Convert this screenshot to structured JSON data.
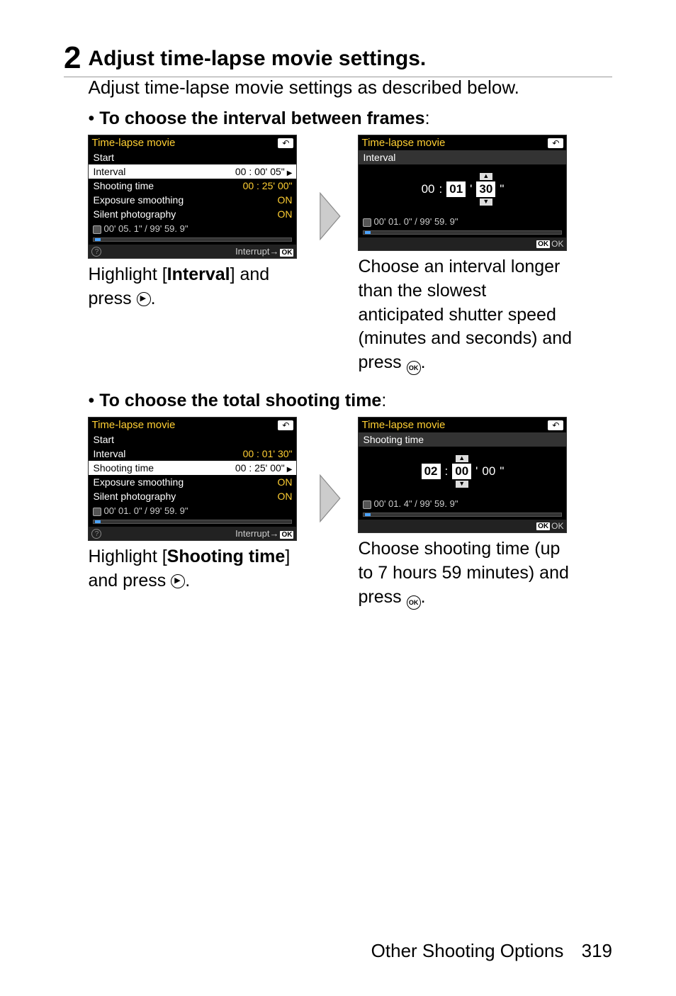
{
  "step": {
    "num": "2",
    "title": "Adjust time-lapse movie settings.",
    "desc": "Adjust time-lapse movie settings as described below."
  },
  "sectionA": {
    "heading_prefix": "• ",
    "heading_bold": "To choose the interval between frames",
    "heading_suffix": ":",
    "left_caption_a": "Highlight [",
    "left_caption_b": "Interval",
    "left_caption_c": "] and press ",
    "left_caption_d": ".",
    "right_caption_a": "Choose an interval longer than the slowest anticipated shutter speed (minutes and seconds) and press ",
    "right_caption_b": "."
  },
  "sectionB": {
    "heading_prefix": "• ",
    "heading_bold": "To choose the total shooting time",
    "heading_suffix": ":",
    "left_caption_a": "Highlight [",
    "left_caption_b": "Shooting time",
    "left_caption_c": "] and press ",
    "left_caption_d": ".",
    "right_caption_a": "Choose shooting time (up to 7 hours 59 minutes) and press ",
    "right_caption_b": "."
  },
  "lcd_common": {
    "title": "Time-lapse movie",
    "start": "Start",
    "interval": "Interval",
    "shooting_time": "Shooting time",
    "exposure_smoothing": "Exposure smoothing",
    "silent_photography": "Silent photography",
    "on": "ON",
    "interrupt": "Interrupt",
    "ok": "OK"
  },
  "lcdA_left": {
    "interval_val": "00 : 00' 05\"",
    "shooting_val": "00 : 25' 00\"",
    "status": "00' 05. 1\" / 99' 59. 9\""
  },
  "lcdA_right": {
    "sub": "Interval",
    "h": "00",
    "m": "01",
    "s": "30",
    "s_label": "\"",
    "m_label": "'",
    "status": "00' 01. 0\" / 99' 59. 9\""
  },
  "lcdB_left": {
    "interval_val": "00 : 01' 30\"",
    "shooting_val": "00 : 25' 00\"",
    "status": "00' 01. 0\" / 99' 59. 9\""
  },
  "lcdB_right": {
    "sub": "Shooting time",
    "h": "02",
    "m": "00",
    "s": "00",
    "m_label": "'",
    "s_label": "\"",
    "status": "00' 01. 4\" / 99' 59. 9\""
  },
  "footer": {
    "section": "Other Shooting Options",
    "page": "319"
  },
  "icon": {
    "ok_text": "OK"
  }
}
